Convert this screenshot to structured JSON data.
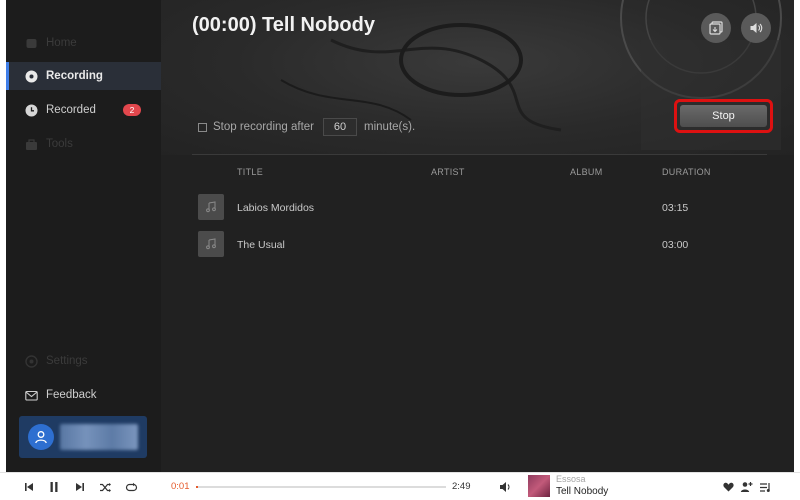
{
  "sidebar": {
    "items": [
      {
        "label": "Home",
        "icon": "home-icon"
      },
      {
        "label": "Recording",
        "icon": "record-icon"
      },
      {
        "label": "Recorded",
        "icon": "clock-icon",
        "badge": "2"
      },
      {
        "label": "Tools",
        "icon": "toolbox-icon"
      }
    ],
    "settings_label": "Settings",
    "feedback_label": "Feedback",
    "user": {
      "avatar_icon": "user-icon"
    }
  },
  "header": {
    "title": "(00:00) Tell Nobody",
    "buttons": [
      {
        "icon": "convert-icon"
      },
      {
        "icon": "volume-icon"
      }
    ]
  },
  "recording": {
    "stop_after_label": "Stop recording after",
    "stop_after_checked": false,
    "minutes_value": "60",
    "minutes_unit": "minute(s).",
    "stop_label": "Stop"
  },
  "table": {
    "columns": [
      "TITLE",
      "ARTIST",
      "ALBUM",
      "DURATION"
    ],
    "rows": [
      {
        "title": "Labios Mordidos",
        "artist": "",
        "album": "",
        "duration": "03:15"
      },
      {
        "title": "The Usual",
        "artist": "",
        "album": "",
        "duration": "03:00"
      }
    ]
  },
  "player": {
    "elapsed": "0:01",
    "total": "2:49",
    "progress_fraction": 0.006,
    "now_playing": {
      "artist": "Essosa",
      "title": "Tell Nobody"
    },
    "controls": [
      "previous-icon",
      "pause-icon",
      "next-icon",
      "shuffle-icon",
      "repeat-icon",
      "volume-icon",
      "heart-icon",
      "add-artist-icon",
      "queue-icon"
    ]
  },
  "colors": {
    "accent": "#3f7ee8",
    "badge": "#e2474d",
    "highlight": "#dd1111",
    "progress": "#e55a2b"
  }
}
